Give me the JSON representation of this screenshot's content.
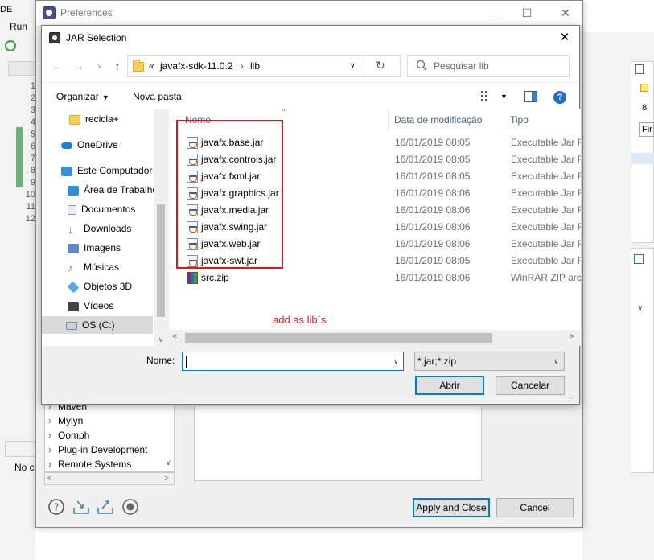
{
  "eclipse": {
    "app_label_partial": "DE",
    "menu_run": "Run",
    "line_numbers": [
      "1",
      "2",
      "3",
      "4",
      "5",
      "6",
      "7",
      "8",
      "9",
      "10",
      "11",
      "12"
    ],
    "right_panel_text": "Fir",
    "bottom_left_text": "No c"
  },
  "preferences": {
    "title": "Preferences",
    "tree_items": [
      "Maven",
      "Mylyn",
      "Oomph",
      "Plug-in Development",
      "Remote Systems"
    ],
    "apply_close_label": "Apply and Close",
    "cancel_label": "Cancel"
  },
  "jar_dialog": {
    "title": "JAR Selection",
    "breadcrumb": [
      "javafx-sdk-11.0.2",
      "lib"
    ],
    "breadcrumb_prefix": "«",
    "search_placeholder": "Pesquisar lib",
    "organize_label": "Organizar",
    "new_folder_label": "Nova pasta",
    "nav_items": [
      {
        "label": "recicla+",
        "icon": "folder-icon",
        "color": "#f6cf5b"
      },
      {
        "label": "OneDrive",
        "icon": "onedrive-icon",
        "color": "#1e7fd8"
      },
      {
        "label": "Este Computador",
        "icon": "computer-icon",
        "color": "#3c8fd6"
      },
      {
        "label": "Área de Trabalho",
        "icon": "desktop-icon",
        "color": "#2f8ee0"
      },
      {
        "label": "Documentos",
        "icon": "documents-icon",
        "color": "#8a9bb0"
      },
      {
        "label": "Downloads",
        "icon": "downloads-icon",
        "color": "#2f7fd1"
      },
      {
        "label": "Imagens",
        "icon": "images-icon",
        "color": "#5c8ac4"
      },
      {
        "label": "Músicas",
        "icon": "music-icon",
        "color": "#3a79c8"
      },
      {
        "label": "Objetos 3D",
        "icon": "objects3d-icon",
        "color": "#55a7e8"
      },
      {
        "label": "Vídeos",
        "icon": "videos-icon",
        "color": "#444444"
      },
      {
        "label": "OS (C:)",
        "icon": "drive-icon",
        "color": "#7a8a99"
      }
    ],
    "columns": [
      "Nome",
      "Data de modificação",
      "Tipo"
    ],
    "files": [
      {
        "name": "javafx.base.jar",
        "date": "16/01/2019 08:05",
        "type": "Executable Jar File",
        "icon": "jar-icon"
      },
      {
        "name": "javafx.controls.jar",
        "date": "16/01/2019 08:05",
        "type": "Executable Jar File",
        "icon": "jar-icon"
      },
      {
        "name": "javafx.fxml.jar",
        "date": "16/01/2019 08:05",
        "type": "Executable Jar File",
        "icon": "jar-icon"
      },
      {
        "name": "javafx.graphics.jar",
        "date": "16/01/2019 08:06",
        "type": "Executable Jar File",
        "icon": "jar-icon"
      },
      {
        "name": "javafx.media.jar",
        "date": "16/01/2019 08:06",
        "type": "Executable Jar File",
        "icon": "jar-icon"
      },
      {
        "name": "javafx.swing.jar",
        "date": "16/01/2019 08:06",
        "type": "Executable Jar File",
        "icon": "jar-icon"
      },
      {
        "name": "javafx.web.jar",
        "date": "16/01/2019 08:06",
        "type": "Executable Jar File",
        "icon": "jar-icon"
      },
      {
        "name": "javafx-swt.jar",
        "date": "16/01/2019 08:05",
        "type": "Executable Jar File",
        "icon": "jar-icon"
      },
      {
        "name": "src.zip",
        "date": "16/01/2019 08:06",
        "type": "WinRAR ZIP archive",
        "icon": "zip-icon"
      }
    ],
    "annotation": "add as lib´s",
    "annotation_color": "#e0161d",
    "name_label": "Nome:",
    "name_value": "",
    "filter_value": "*.jar;*.zip",
    "open_label": "Abrir",
    "cancel_label": "Cancelar",
    "accent_color": "#0078d7"
  }
}
